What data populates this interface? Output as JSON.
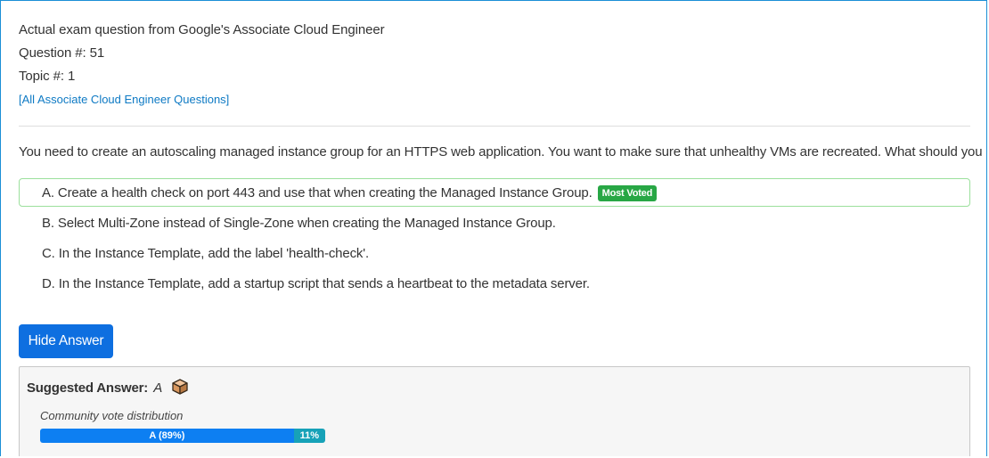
{
  "header": {
    "exam_line": "Actual exam question from Google's Associate Cloud Engineer",
    "question_number": "Question #: 51",
    "topic": "Topic #: 1",
    "all_questions_link": "[All Associate Cloud Engineer Questions]"
  },
  "question": {
    "text": "You need to create an autoscaling managed instance group for an HTTPS web application. You want to make sure that unhealthy VMs are recreated. What should you do?"
  },
  "choices": [
    {
      "letter": "A.",
      "text": "Create a health check on port 443 and use that when creating the Managed Instance Group.",
      "badge": "Most Voted",
      "correct": true
    },
    {
      "letter": "B.",
      "text": "Select Multi-Zone instead of Single-Zone when creating the Managed Instance Group.",
      "correct": false
    },
    {
      "letter": "C.",
      "text": "In the Instance Template, add the label 'health-check'.",
      "correct": false
    },
    {
      "letter": "D.",
      "text": "In the Instance Template, add a startup script that sends a heartbeat to the metadata server.",
      "correct": false
    }
  ],
  "buttons": {
    "hide_answer": "Hide Answer"
  },
  "answer": {
    "label": "Suggested Answer:",
    "value": "A",
    "vote_title": "Community vote distribution",
    "votes": [
      {
        "label": "A (89%)",
        "percent": 89,
        "color": "#0d7ff2"
      },
      {
        "label": "11%",
        "percent": 11,
        "color": "#17a2b8"
      }
    ]
  },
  "colors": {
    "link": "#0e7ac4",
    "primary_button": "#0e6fe0",
    "badge_green": "#28a745",
    "correct_border": "#9be09c",
    "frame_border": "#1b8fd6"
  }
}
